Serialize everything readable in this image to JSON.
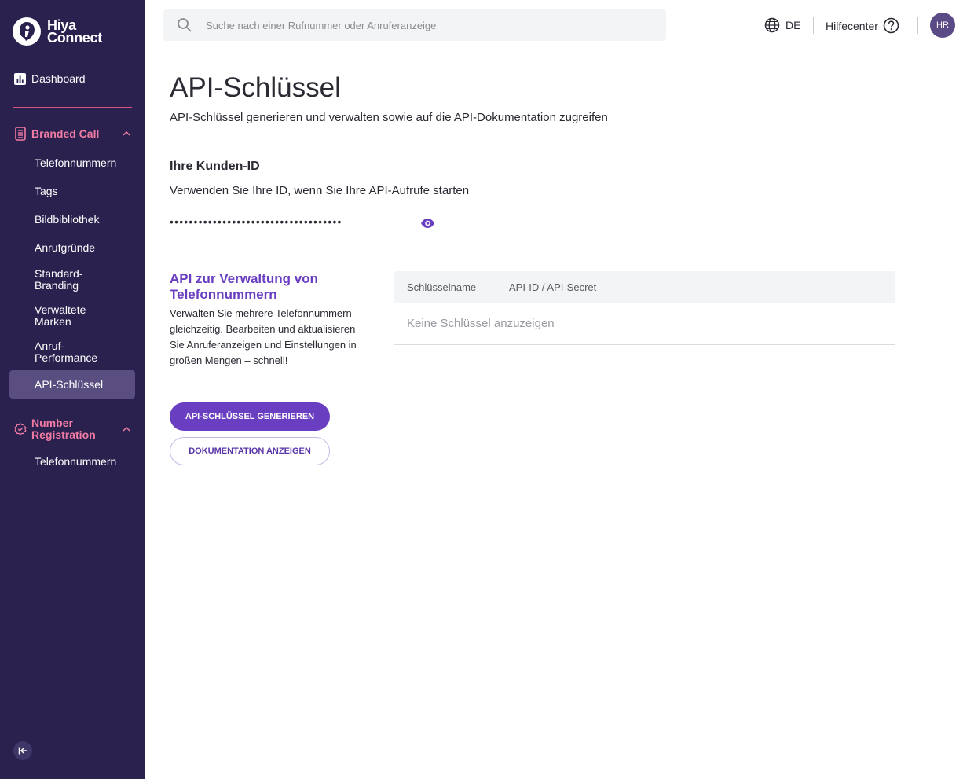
{
  "app": {
    "logo_line1": "Hiya",
    "logo_line2": "Connect",
    "logo_icon": "hiya-logo-icon"
  },
  "sidebar": {
    "dashboard": {
      "label": "Dashboard",
      "icon": "bar-chart-icon"
    },
    "branded_call": {
      "label": "Branded Call",
      "icon": "phone-icon",
      "items": [
        {
          "label": "Telefonnummern"
        },
        {
          "label": "Tags"
        },
        {
          "label": "Bildbibliothek"
        },
        {
          "label": "Anrufgründe"
        },
        {
          "label": "Standard-\nBranding"
        },
        {
          "label": "Verwaltete\nMarken"
        },
        {
          "label": "Anruf-\nPerformance"
        },
        {
          "label": "API-Schlüssel",
          "active": true
        }
      ]
    },
    "number_registration": {
      "label": "Number\nRegistration",
      "icon": "badge-check-icon",
      "items": [
        {
          "label": "Telefonnummern"
        }
      ]
    },
    "collapse_icon": "collapse-left-icon"
  },
  "topbar": {
    "search_placeholder": "Suche nach einer Rufnummer oder Anruferanzeige",
    "language": "DE",
    "help": "Hilfecenter",
    "avatar": "HR"
  },
  "main": {
    "title": "API-Schlüssel",
    "subtitle": "API-Schlüssel generieren und verwalten sowie auf die API-Dokumentation zugreifen",
    "customer_id": {
      "title": "Ihre Kunden-ID",
      "description": "Verwenden Sie Ihre ID, wenn Sie Ihre API-Aufrufe starten",
      "masked_value": "••••••••••••••••••••••••••••••••••••"
    },
    "api_section": {
      "title": "API zur Verwaltung von Telefonnummern",
      "description": "Verwalten Sie mehrere Telefonnummern gleichzeitig. Bearbeiten und aktualisieren Sie Anruferanzeigen und Einstellungen in großen Mengen – schnell!",
      "generate_button": "API-SCHLÜSSEL GENERIEREN",
      "docs_button": "DOKUMENTATION ANZEIGEN"
    },
    "table": {
      "columns": [
        "Schlüsselname",
        "API-ID / API-Secret"
      ],
      "empty_text": "Keine Schlüssel anzuzeigen"
    }
  },
  "colors": {
    "sidebar_bg": "#2a214f",
    "accent_pink": "#f07ba3",
    "primary_purple": "#6a3ec0"
  }
}
